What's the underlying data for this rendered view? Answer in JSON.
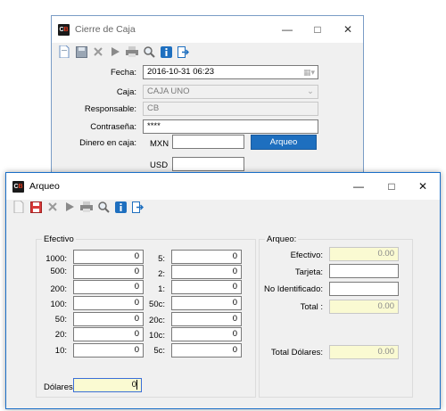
{
  "window1": {
    "title": "Cierre de Caja",
    "fecha_label": "Fecha:",
    "fecha_value": "2016-10-31 06:23",
    "caja_label": "Caja:",
    "caja_value": "CAJA UNO",
    "responsable_label": "Responsable:",
    "responsable_value": "CB",
    "contrasena_label": "Contraseña:",
    "contrasena_value": "****",
    "dinero_label": "Dinero en caja:",
    "mxn_label": "MXN",
    "usd_label": "USD",
    "mxn_value": "",
    "usd_value": "",
    "arqueo_button": "Arqueo"
  },
  "window2": {
    "title": "Arqueo",
    "efectivo_group": "Efectivo",
    "arqueo_group": "Arqueo:",
    "bills": [
      {
        "label": "1000:",
        "value": "0"
      },
      {
        "label": "500:",
        "value": "0"
      },
      {
        "label": "200:",
        "value": "0"
      },
      {
        "label": "100:",
        "value": "0"
      },
      {
        "label": "50:",
        "value": "0"
      },
      {
        "label": "20:",
        "value": "0"
      },
      {
        "label": "10:",
        "value": "0"
      }
    ],
    "coins": [
      {
        "label": "5:",
        "value": "0"
      },
      {
        "label": "2:",
        "value": "0"
      },
      {
        "label": "1:",
        "value": "0"
      },
      {
        "label": "50c:",
        "value": "0"
      },
      {
        "label": "20c:",
        "value": "0"
      },
      {
        "label": "10c:",
        "value": "0"
      },
      {
        "label": "5c:",
        "value": "0"
      }
    ],
    "dolares_label": "Dólares",
    "dolares_value": "0",
    "efectivo_label": "Efectivo:",
    "efectivo_value": "0.00",
    "tarjeta_label": "Tarjeta:",
    "tarjeta_value": "",
    "noid_label": "No Identificado:",
    "noid_value": "",
    "total_label": "Total :",
    "total_value": "0.00",
    "total_dolares_label": "Total Dólares:",
    "total_dolares_value": "0.00"
  },
  "icons": [
    "new-icon",
    "save-icon",
    "delete-icon",
    "play-icon",
    "print-icon",
    "search-icon",
    "info-icon",
    "exit-icon"
  ],
  "colors": {
    "accent": "#1e6fbf",
    "readonly": "#fafad2"
  }
}
